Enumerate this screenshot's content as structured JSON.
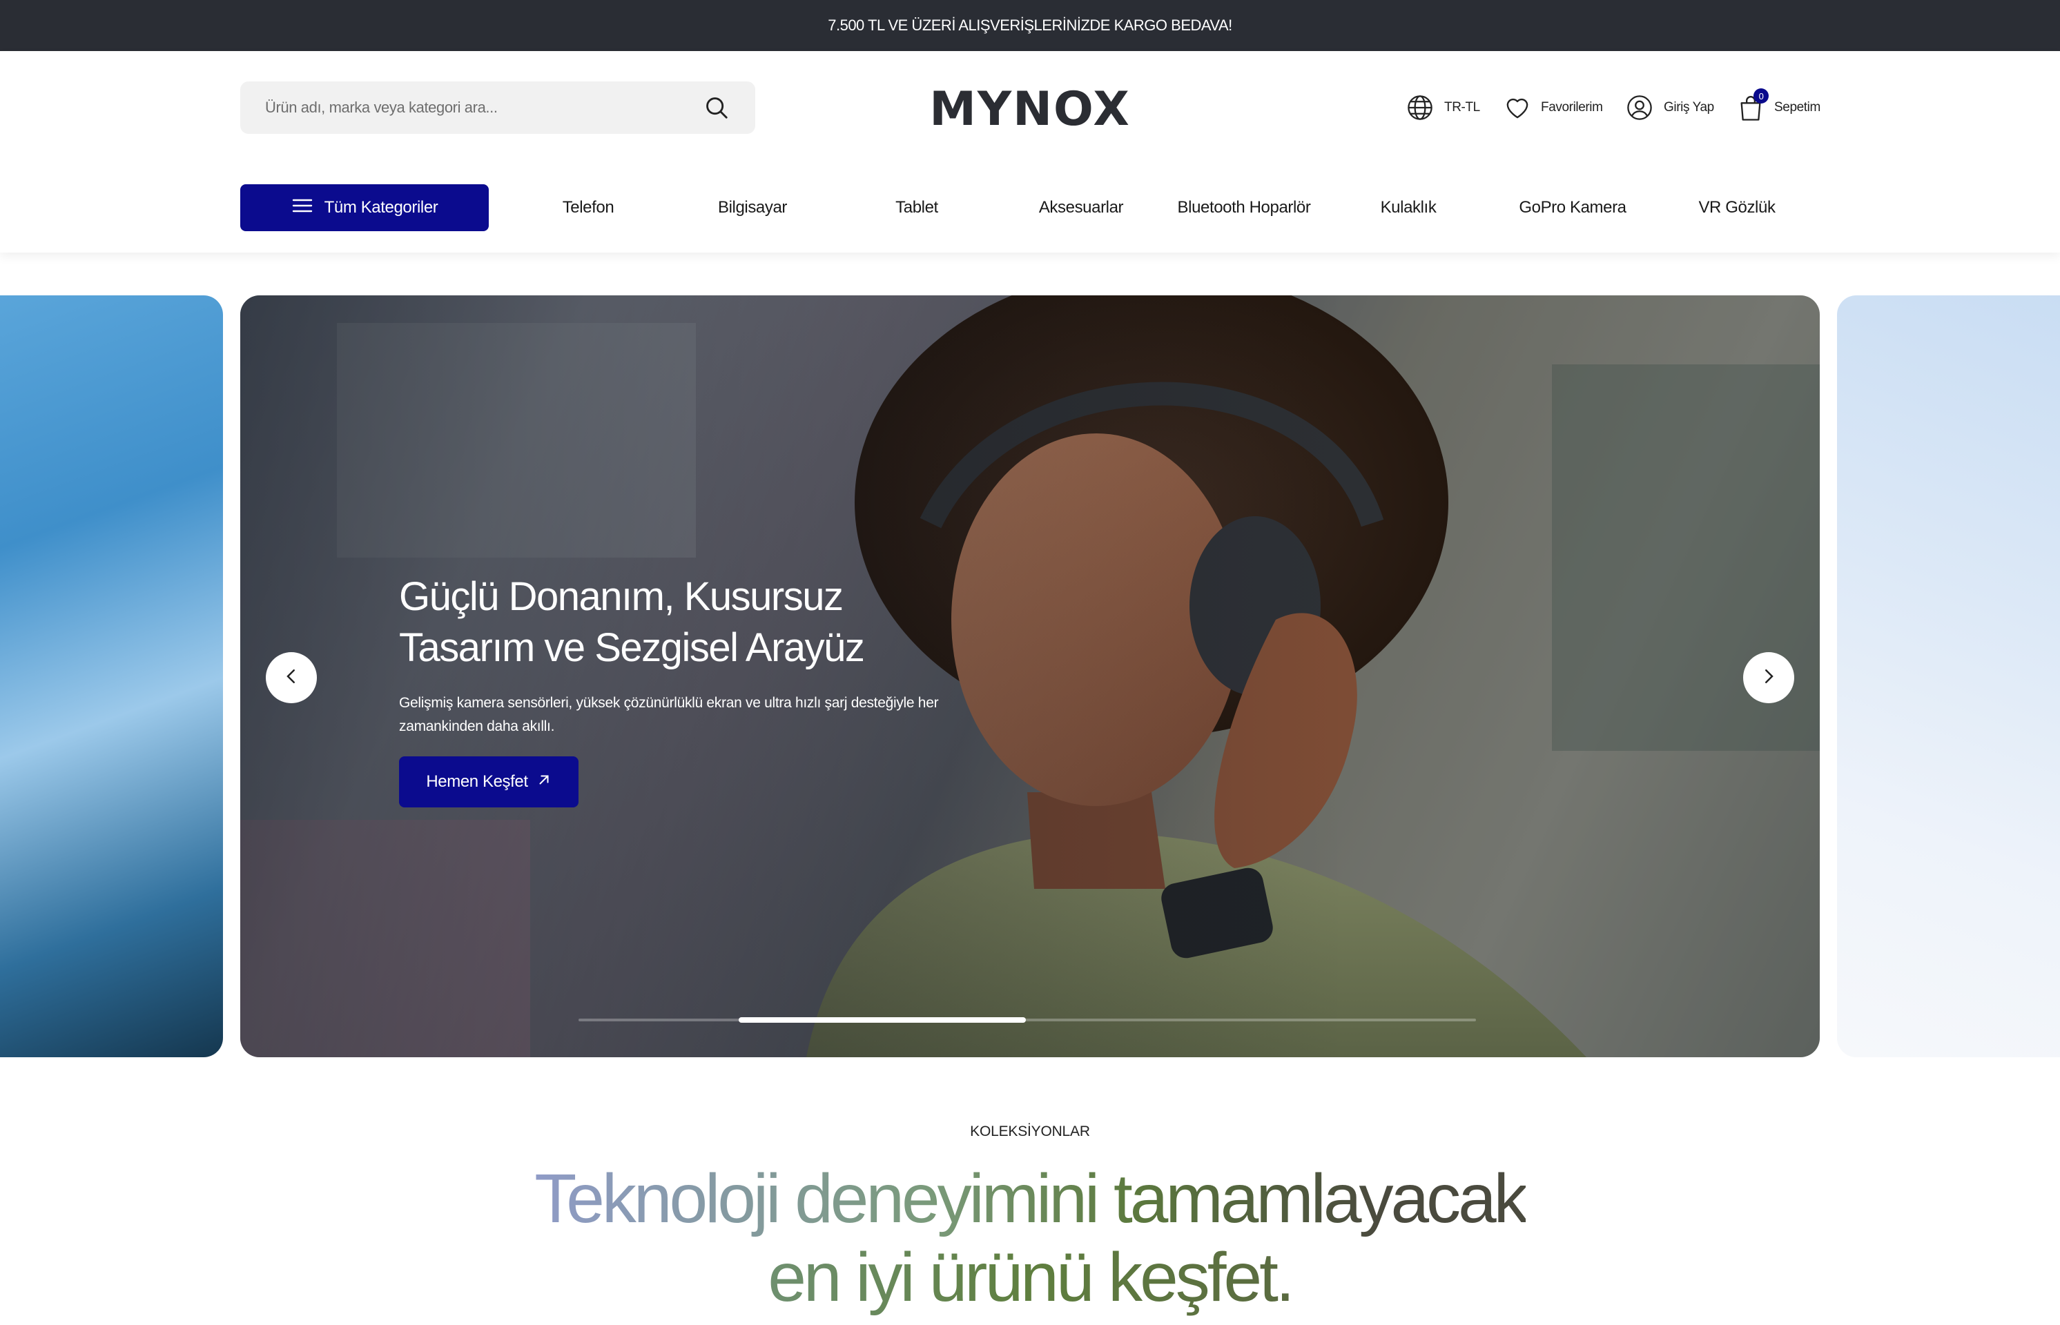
{
  "announcement": "7.500 TL VE ÜZERİ ALIŞVERİŞLERİNİZDE KARGO BEDAVA!",
  "header": {
    "search_placeholder": "Ürün adı, marka veya kategori ara...",
    "logo": "MYNOX",
    "language": "TR-TL",
    "favorites": "Favorilerim",
    "login": "Giriş Yap",
    "cart": "Sepetim",
    "cart_count": "0"
  },
  "nav": {
    "all_categories": "Tüm Kategoriler",
    "items": [
      "Telefon",
      "Bilgisayar",
      "Tablet",
      "Aksesuarlar",
      "Bluetooth Hoparlör",
      "Kulaklık",
      "GoPro Kamera",
      "VR Gözlük"
    ]
  },
  "hero": {
    "title_line1": "Güçlü Donanım, Kusursuz",
    "title_line2": "Tasarım ve Sezgisel Arayüz",
    "subtitle_line1": "Gelişmiş kamera sensörleri, yüksek çözünürlüklü ekran ve ultra hızlı şarj desteğiyle her",
    "subtitle_line2": "zamankinden daha akıllı.",
    "cta": "Hemen Keşfet",
    "slide_progress": 0.32
  },
  "collections": {
    "eyebrow": "KOLEKSİYONLAR",
    "headline_line1": "Teknoloji deneyimini tamamlayacak",
    "headline_line2": "en iyi ürünü keşfet."
  },
  "colors": {
    "primary": "#0b0b8e",
    "topbar": "#2a2d34"
  }
}
